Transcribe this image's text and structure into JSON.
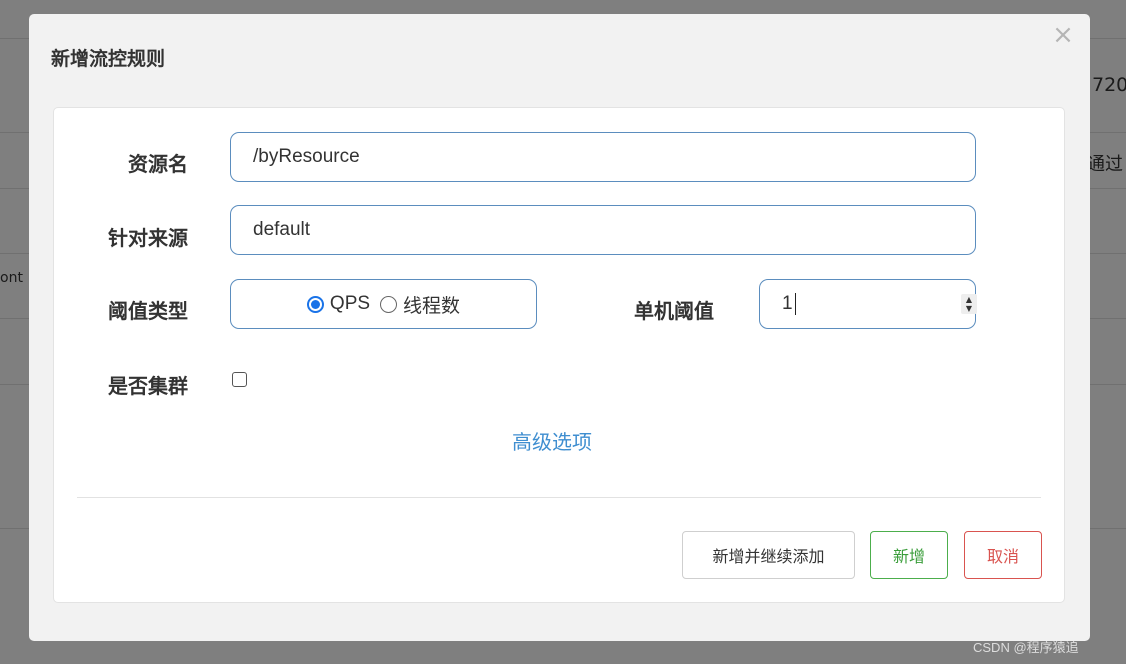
{
  "background": {
    "fragments": [
      "720",
      "通过",
      "ont"
    ]
  },
  "dialog": {
    "title": "新增流控规则",
    "close_glyph": "×",
    "fields": {
      "resource_label": "资源名",
      "resource_value": "/byResource",
      "source_label": "针对来源",
      "source_value": "default",
      "threshold_type_label": "阈值类型",
      "threshold_type_options": [
        "QPS",
        "线程数"
      ],
      "threshold_type_selected": "QPS",
      "single_threshold_label": "单机阈值",
      "single_threshold_value": "1",
      "cluster_label": "是否集群",
      "cluster_checked": false
    },
    "advanced_link": "高级选项",
    "buttons": {
      "add_continue": "新增并继续添加",
      "add": "新增",
      "cancel": "取消"
    }
  },
  "watermark": "CSDN @程序猿追",
  "colors": {
    "input_border": "#5b8dbe",
    "link": "#3f8ed0",
    "success": "#4cae4c",
    "danger": "#d9534f",
    "radio_checked": "#1a73e8"
  },
  "icons": {
    "close": "close-icon",
    "spinner": "spinner-arrows-icon"
  }
}
